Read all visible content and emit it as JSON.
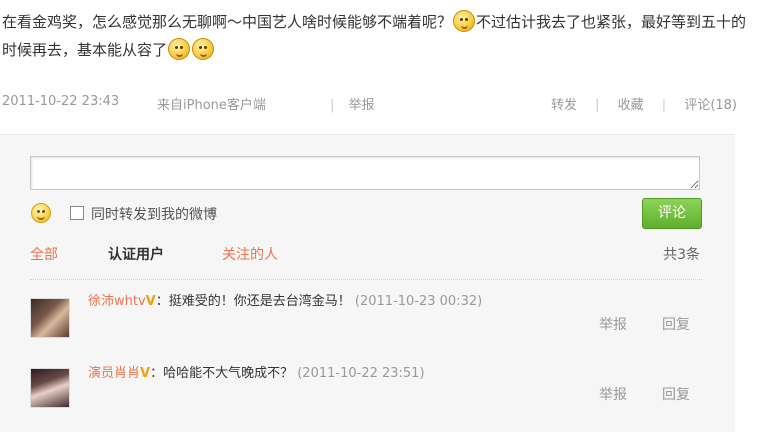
{
  "post": {
    "text_part1": "在看金鸡奖，怎么感觉那么无聊啊～中国艺人啥时候能够不端着呢？",
    "text_part2": "不过估计我去了也紧张，最好等到五十的时候再去，基本能从容了",
    "emoticons": [
      "kiss-face-emoticon",
      "laugh-face-emoticon",
      "laugh-face-emoticon"
    ]
  },
  "meta": {
    "time": "2011-10-22 23:43",
    "source": "来自iPhone客户端",
    "separator": "|",
    "report": "举报",
    "repost": "转发",
    "favorite": "收藏",
    "comment": "评论(18)"
  },
  "composer": {
    "input_value": "",
    "also_repost_label": "同时转发到我的微博",
    "submit_label": "评论"
  },
  "tabs": {
    "all": "全部",
    "verified": "认证用户",
    "following": "关注的人"
  },
  "count_label": "共3条",
  "comments": [
    {
      "author": "徐沛whtv",
      "verified_mark": "V",
      "text": "：挺难受的！你还是去台湾金马！",
      "time": "(2011-10-23 00:32)",
      "report": "举报",
      "reply": "回复"
    },
    {
      "author": "演员肖肖",
      "verified_mark": "V",
      "text": "：哈哈能不大气晚成不？",
      "time": "(2011-10-22 23:51)",
      "report": "举报",
      "reply": "回复"
    }
  ],
  "colors": {
    "link_orange": "#eb7350",
    "button_green": "#5fae2c",
    "muted_text": "#999999",
    "verified_gold": "#f0a010"
  }
}
